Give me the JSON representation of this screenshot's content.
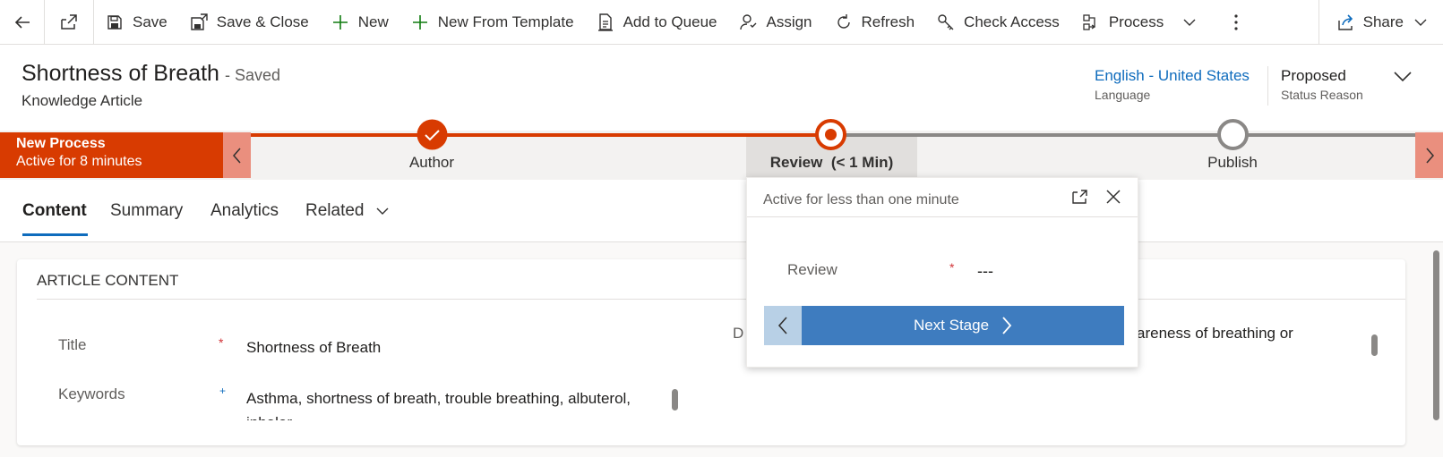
{
  "toolbar": {
    "save": "Save",
    "save_close": "Save & Close",
    "new": "New",
    "new_from_template": "New From Template",
    "add_to_queue": "Add to Queue",
    "assign": "Assign",
    "refresh": "Refresh",
    "check_access": "Check Access",
    "process": "Process",
    "share": "Share"
  },
  "header": {
    "title": "Shortness of Breath",
    "saved": "- Saved",
    "entity": "Knowledge Article",
    "language_value": "English - United States",
    "language_label": "Language",
    "status_value": "Proposed",
    "status_label": "Status Reason"
  },
  "bpf": {
    "process_name": "New Process",
    "process_active": "Active for 8 minutes",
    "stages": [
      {
        "label": "Author",
        "state": "completed"
      },
      {
        "label": "Review",
        "duration": "(< 1 Min)",
        "state": "active"
      },
      {
        "label": "Publish",
        "state": "pending"
      }
    ]
  },
  "tabs": [
    "Content",
    "Summary",
    "Analytics",
    "Related"
  ],
  "section": {
    "title": "ARTICLE CONTENT",
    "fields": [
      {
        "label": "Title",
        "value": "Shortness of Breath"
      },
      {
        "label": "Keywords",
        "value": "Asthma, shortness of breath, trouble breathing, albuterol,",
        "value_line2": "inhaler"
      }
    ],
    "right_partial_label": "D",
    "right_partial_value": "areness of breathing or"
  },
  "flyout": {
    "header": "Active for less than one minute",
    "field_label": "Review",
    "field_value": "---",
    "next_stage": "Next Stage"
  },
  "colors": {
    "accent": "#d83b01",
    "stage_line_done": "#d83b01",
    "link": "#0f6cbd",
    "button": "#3e7cbf"
  }
}
